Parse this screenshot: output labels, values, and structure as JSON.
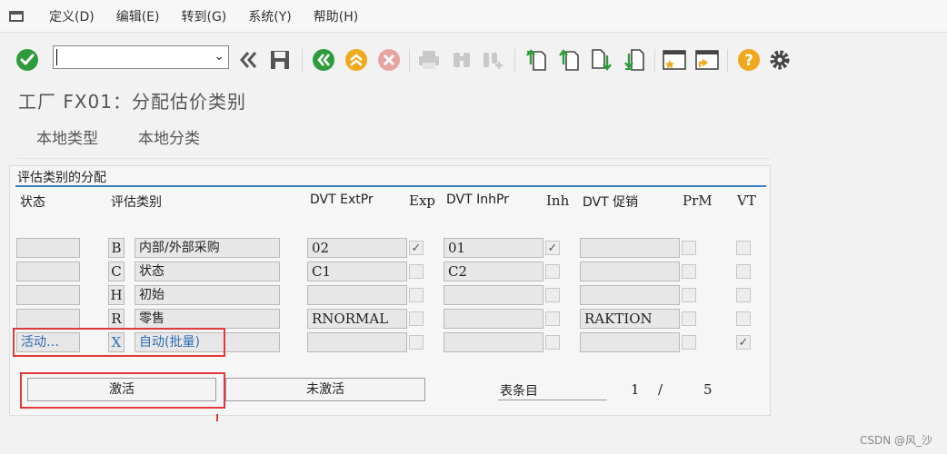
{
  "menu": {
    "items": [
      "定义(D)",
      "编辑(E)",
      "转到(G)",
      "系统(Y)",
      "帮助(H)"
    ]
  },
  "toolbar": {
    "command_value": "",
    "icons": [
      "enter-icon",
      "back-double-icon",
      "save-icon",
      "back-icon",
      "exit-icon",
      "cancel-icon",
      "print-icon",
      "find-icon",
      "find-next-icon",
      "first-page-icon",
      "previous-page-icon",
      "next-page-icon",
      "last-page-icon",
      "new-session-icon",
      "shortcut-icon",
      "help-icon",
      "settings-icon"
    ]
  },
  "title": "工厂 FX01：分配估价类别",
  "tabs": [
    "本地类型",
    "本地分类"
  ],
  "group": {
    "title": "评估类别的分配",
    "headers": {
      "status": "状态",
      "valuation_category": "评估类别",
      "dvt_ext": "DVT ExtPr",
      "exp": "Exp",
      "dvt_inh": "DVT InhPr",
      "inh": "Inh",
      "dvt_promo": "DVT 促销",
      "prm": "PrM",
      "vt": "VT"
    },
    "rows": [
      {
        "status": "",
        "key": "B",
        "desc": "内部/外部采购",
        "ext": "02",
        "exp": true,
        "inh_val": "01",
        "inh": true,
        "promo": "",
        "prm": false,
        "vt": false
      },
      {
        "status": "",
        "key": "C",
        "desc": "状态",
        "ext": "C1",
        "exp": false,
        "inh_val": "C2",
        "inh": false,
        "promo": "",
        "prm": false,
        "vt": false
      },
      {
        "status": "",
        "key": "H",
        "desc": "初始",
        "ext": "",
        "exp": false,
        "inh_val": "",
        "inh": false,
        "promo": "",
        "prm": false,
        "vt": false
      },
      {
        "status": "",
        "key": "R",
        "desc": "零售",
        "ext": "RNORMAL",
        "exp": false,
        "inh_val": "",
        "inh": false,
        "promo": "RAKTION",
        "prm": false,
        "vt": false
      },
      {
        "status": "活动…",
        "key": "X",
        "desc": "自动(批量)",
        "ext": "",
        "exp": false,
        "inh_val": "",
        "inh": false,
        "promo": "",
        "prm": false,
        "vt": true
      }
    ]
  },
  "buttons": {
    "activate": "激活",
    "deactivate": "未激活"
  },
  "entries": {
    "label": "表条目",
    "current": "1",
    "separator": "/",
    "total": "5"
  },
  "watermark": "CSDN @风_沙",
  "colors": {
    "highlight_frame": "#e0393a",
    "accent_line": "#3c7ec1",
    "active_text": "#2d6cb5"
  }
}
